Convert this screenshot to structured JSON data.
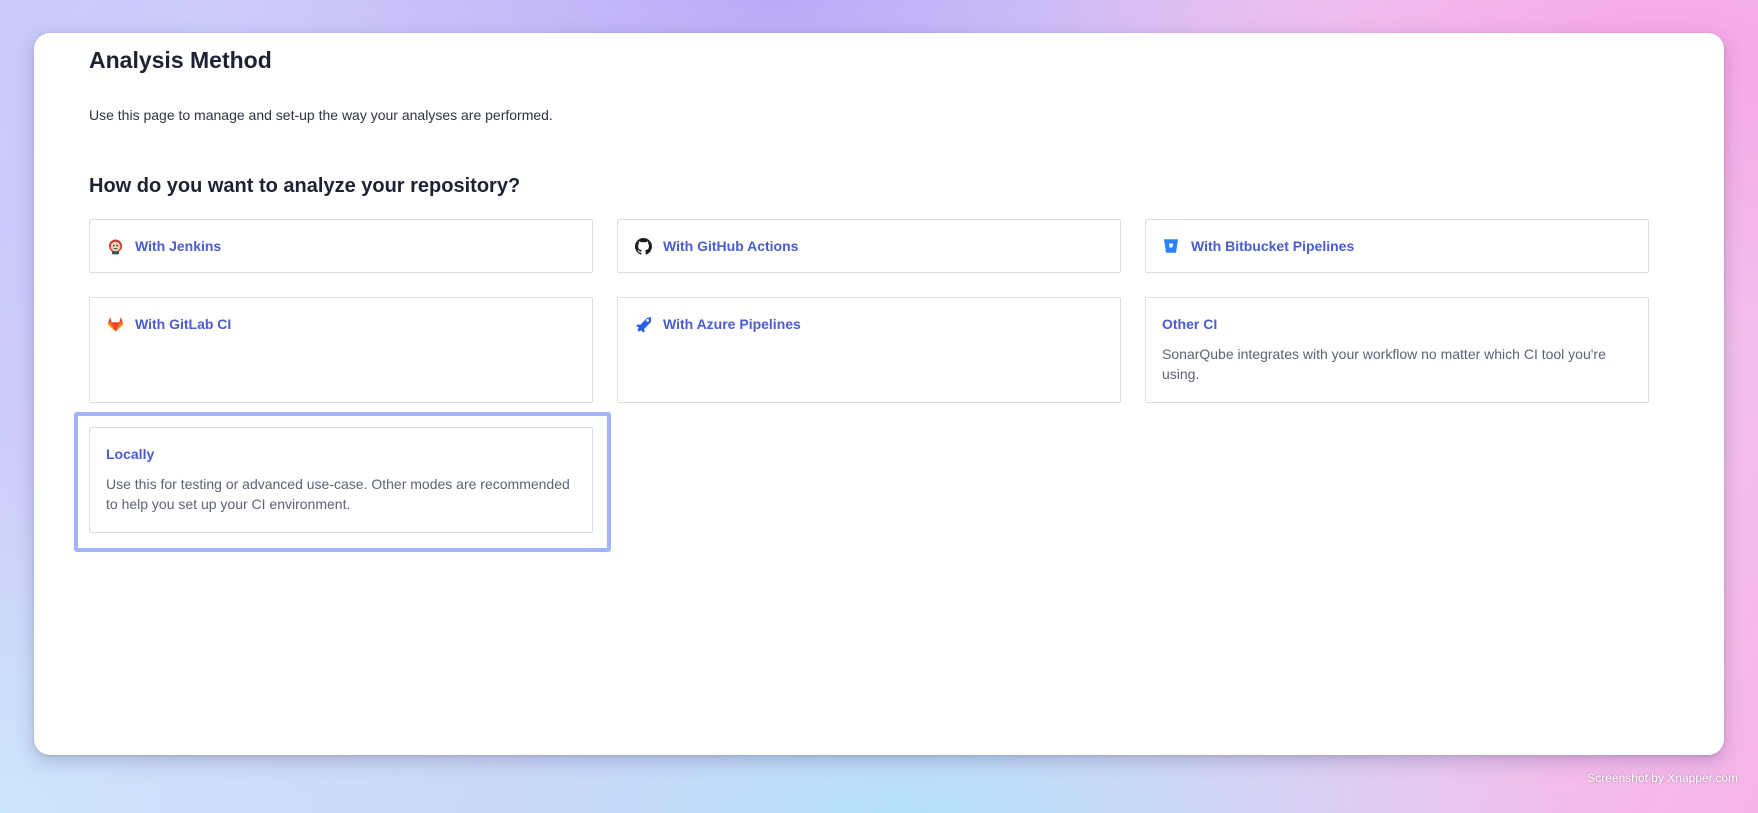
{
  "page": {
    "title": "Analysis Method",
    "description": "Use this page to manage and set-up the way your analyses are performed.",
    "question": "How do you want to analyze your repository?"
  },
  "options": [
    {
      "label": "With Jenkins",
      "icon": "jenkins-icon",
      "description": ""
    },
    {
      "label": "With GitHub Actions",
      "icon": "github-icon",
      "description": ""
    },
    {
      "label": "With Bitbucket Pipelines",
      "icon": "bitbucket-icon",
      "description": ""
    },
    {
      "label": "With GitLab CI",
      "icon": "gitlab-icon",
      "description": ""
    },
    {
      "label": "With Azure Pipelines",
      "icon": "azure-pipelines-icon",
      "description": ""
    },
    {
      "label": "Other CI",
      "icon": "",
      "description": "SonarQube integrates with your workflow no matter which CI tool you're using."
    },
    {
      "label": "Locally",
      "icon": "",
      "description": "Use this for testing or advanced use-case. Other modes are recommended to help you set up your CI environment."
    }
  ],
  "colors": {
    "accent": "#4a5cd0",
    "highlight": "#a3b4f6",
    "gitlab": "#e24329",
    "bitbucket": "#2684ff",
    "azure": "#2560e0"
  },
  "watermark": "Screenshot by Xnapper.com"
}
